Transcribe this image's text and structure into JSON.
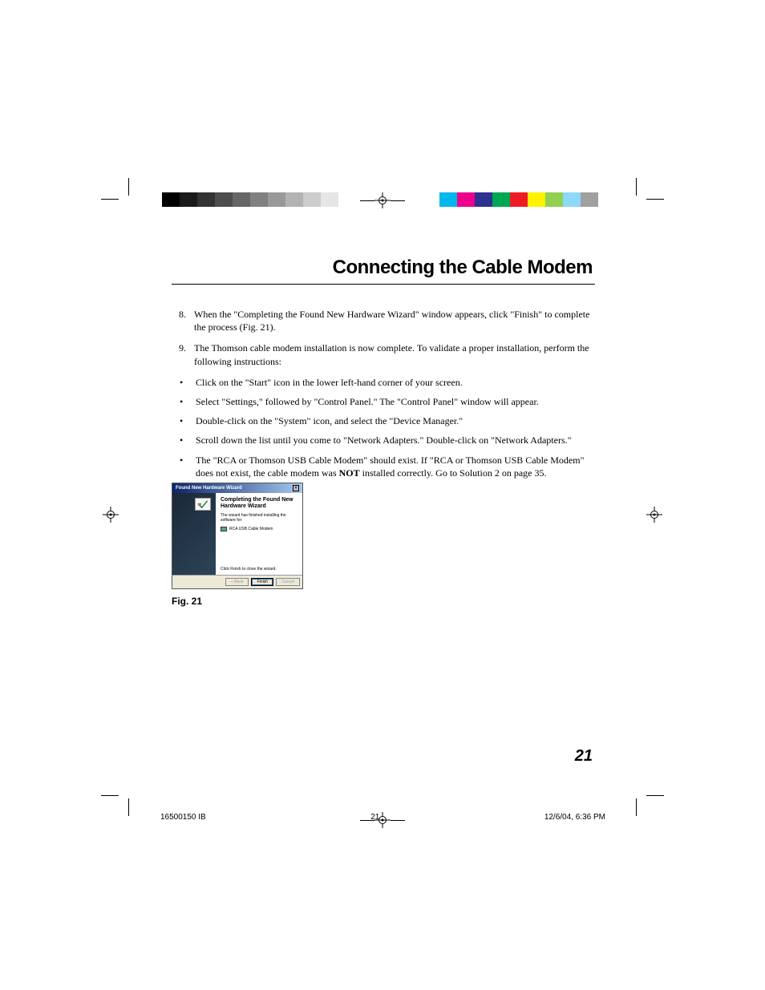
{
  "page": {
    "title": "Connecting the Cable Modem",
    "number": "21",
    "footer": {
      "doc": "16500150 IB",
      "sheet": "21",
      "date": "12/6/04, 6:36 PM"
    }
  },
  "ol": [
    {
      "n": "8.",
      "text": "When the \"Completing the Found New Hardware Wizard\" window appears, click \"Finish\" to complete the process (Fig. 21)."
    },
    {
      "n": "9.",
      "text": "The Thomson cable modem installation is now complete. To validate a proper installation, perform the following instructions:"
    }
  ],
  "bullets": [
    "Click on the \"Start\" icon in the lower left-hand corner of your screen.",
    "Select \"Settings,\" followed by \"Control Panel.\" The \"Control Panel\" window will appear.",
    "Double-click on the \"System\" icon, and select the \"Device Manager.\"",
    "Scroll down the list until you come to \"Network Adapters.\"  Double-click on \"Network Adapters.\""
  ],
  "last_bullet": {
    "pre": "The \"RCA or Thomson USB Cable Modem\" should exist.  If \"RCA or Thomson USB Cable Modem\" does not exist, the cable modem was ",
    "bold": "NOT",
    "post": " installed correctly. Go to Solution 2 on page 35."
  },
  "figure": {
    "caption": "Fig. 21",
    "wizard": {
      "titlebar": "Found New Hardware Wizard",
      "heading": "Completing the Found New Hardware Wizard",
      "line1": "The wizard has finished installing the software for:",
      "device": "RCA USB Cable Modem",
      "hint": "Click Finish to close the wizard.",
      "btn_back": "< Back",
      "btn_finish": "Finish",
      "btn_cancel": "Cancel"
    }
  },
  "swatches": {
    "gray": [
      "#000000",
      "#1a1a1a",
      "#333333",
      "#4d4d4d",
      "#666666",
      "#808080",
      "#999999",
      "#b3b3b3",
      "#cccccc",
      "#e6e6e6"
    ],
    "color": [
      "#00b7eb",
      "#ec008c",
      "#2e3192",
      "#00a651",
      "#ed1c24",
      "#fff200",
      "#92d050",
      "#8ed8f8",
      "#a0a0a0"
    ]
  }
}
